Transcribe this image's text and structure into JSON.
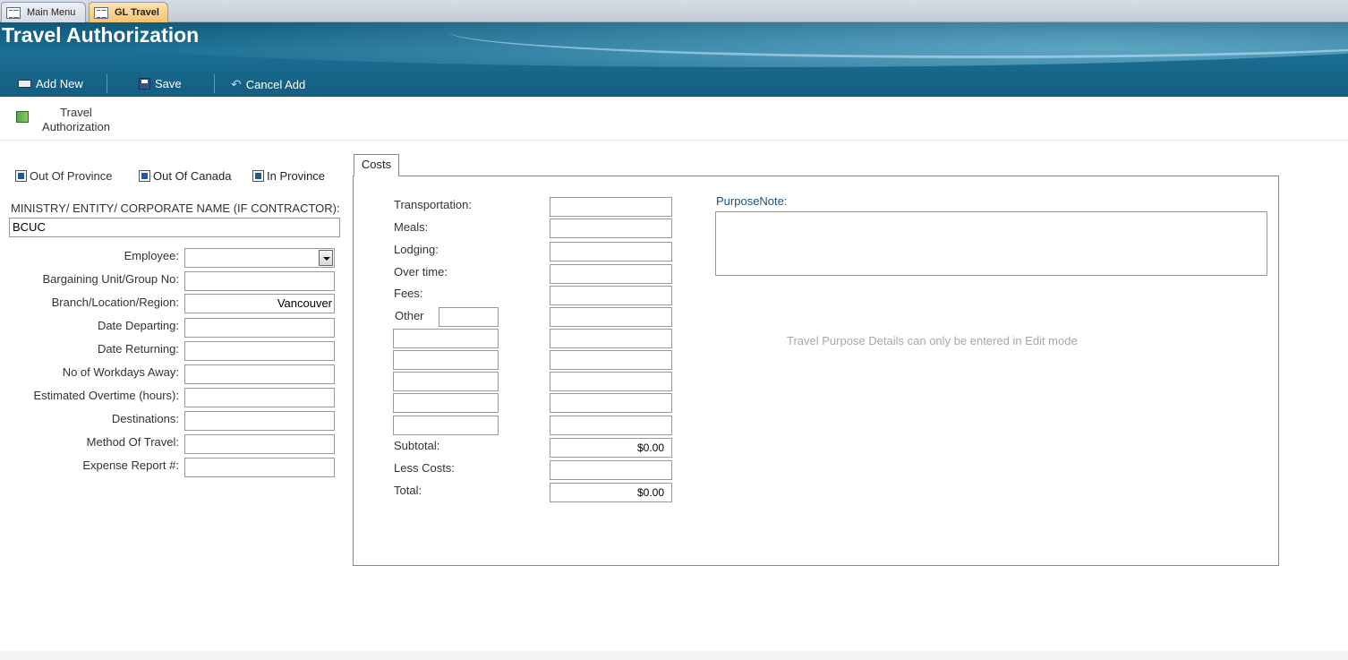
{
  "tabs": [
    {
      "label": "Main Menu",
      "active": false
    },
    {
      "label": "GL Travel",
      "active": true
    }
  ],
  "header": {
    "title": "Travel Authorization",
    "buttons": {
      "add_new": "Add New",
      "save": "Save",
      "cancel_add": "Cancel Add"
    }
  },
  "nav": {
    "travel_authorization_label": "Travel Authorization"
  },
  "checkboxes": {
    "out_of_province": {
      "label": "Out Of Province",
      "checked": true
    },
    "out_of_canada": {
      "label": "Out Of Canada",
      "checked": true
    },
    "in_province": {
      "label": "In Province",
      "checked": true
    }
  },
  "ministry": {
    "label": "MINISTRY/ ENTITY/ CORPORATE NAME (IF CONTRACTOR):",
    "value": "BCUC"
  },
  "fields": {
    "employee": {
      "label": "Employee:",
      "value": ""
    },
    "bargaining_unit": {
      "label": "Bargaining Unit/Group No:",
      "value": ""
    },
    "branch": {
      "label": "Branch/Location/Region:",
      "value": "Vancouver"
    },
    "date_departing": {
      "label": "Date Departing:",
      "value": ""
    },
    "date_returning": {
      "label": "Date Returning:",
      "value": ""
    },
    "workdays_away": {
      "label": "No of Workdays Away:",
      "value": ""
    },
    "estimated_overtime": {
      "label": "Estimated Overtime (hours):",
      "value": ""
    },
    "destinations": {
      "label": "Destinations:",
      "value": ""
    },
    "method_of_travel": {
      "label": "Method Of Travel:",
      "value": ""
    },
    "expense_report": {
      "label": "Expense Report #:",
      "value": ""
    }
  },
  "costs": {
    "tab_label": "Costs",
    "transportation": {
      "label": "Transportation:",
      "value": ""
    },
    "meals": {
      "label": "Meals:",
      "value": ""
    },
    "lodging": {
      "label": "Lodging:",
      "value": ""
    },
    "over_time": {
      "label": "Over time:",
      "value": ""
    },
    "fees": {
      "label": "Fees:",
      "value": ""
    },
    "other": {
      "label": "Other",
      "value": ""
    },
    "subtotal": {
      "label": "Subtotal:",
      "value": "$0.00"
    },
    "less_costs": {
      "label": "Less Costs:",
      "value": ""
    },
    "total": {
      "label": "Total:",
      "value": "$0.00"
    }
  },
  "purpose": {
    "label": "PurposeNote:",
    "edit_mode_message": "Travel Purpose Details can only be entered in Edit mode"
  }
}
